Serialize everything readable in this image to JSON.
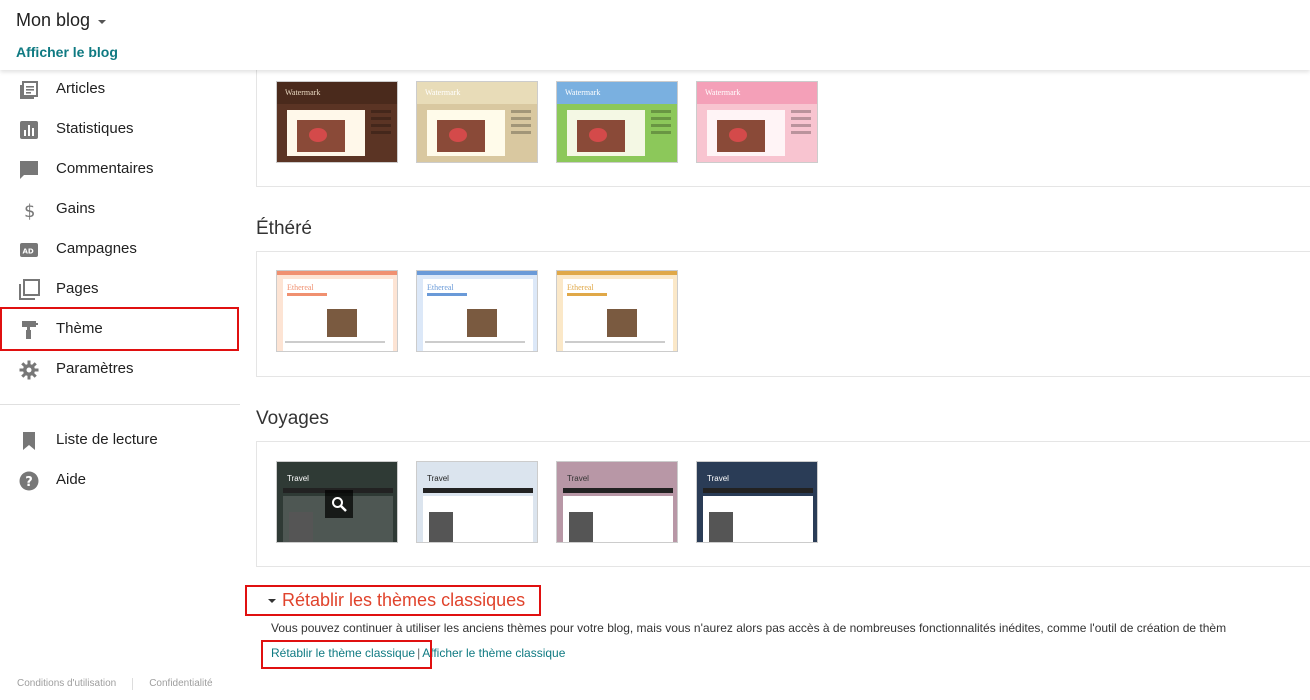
{
  "header": {
    "blog_name": "Mon blog",
    "view_blog": "Afficher le blog"
  },
  "sidebar": {
    "items": [
      {
        "label": "Articles",
        "icon": "articles-icon"
      },
      {
        "label": "Statistiques",
        "icon": "stats-icon"
      },
      {
        "label": "Commentaires",
        "icon": "comment-icon"
      },
      {
        "label": "Gains",
        "icon": "dollar-icon"
      },
      {
        "label": "Campagnes",
        "icon": "ad-icon"
      },
      {
        "label": "Pages",
        "icon": "pages-icon"
      },
      {
        "label": "Thème",
        "icon": "paint-roller-icon"
      },
      {
        "label": "Paramètres",
        "icon": "gear-icon"
      }
    ],
    "secondary": [
      {
        "label": "Liste de lecture",
        "icon": "bookmark-icon"
      },
      {
        "label": "Aide",
        "icon": "help-icon"
      }
    ],
    "footer": {
      "terms": "Conditions d'utilisation",
      "privacy": "Confidentialité"
    }
  },
  "sections": {
    "watermark": {
      "themes": [
        {
          "name": "Watermark",
          "header_color": "#4a2a1c",
          "bg": "#5b3424",
          "post": "#fff8ea"
        },
        {
          "name": "Watermark",
          "header_color": "#e8dcb8",
          "bg": "#d9c8a0",
          "post": "#fffbea"
        },
        {
          "name": "Watermark",
          "header_color": "#7ab0e0",
          "bg": "#8cc85a",
          "post": "#f4f8e4"
        },
        {
          "name": "Watermark",
          "header_color": "#f4a0b8",
          "bg": "#f8c4d0",
          "post": "#fff4f6"
        }
      ]
    },
    "ethere": {
      "title": "Éthéré",
      "themes": [
        {
          "name": "Ethereal",
          "accent": "#f09070",
          "bg": "#fde4d4"
        },
        {
          "name": "Ethereal",
          "accent": "#6a9ad8",
          "bg": "#dce8f8"
        },
        {
          "name": "Ethereal",
          "accent": "#e0a848",
          "bg": "#fbe8c8"
        }
      ]
    },
    "voyages": {
      "title": "Voyages",
      "themes": [
        {
          "name": "Travel",
          "bg": "#2f3a35"
        },
        {
          "name": "Travel",
          "bg": "#dbe4ee"
        },
        {
          "name": "Travel",
          "bg": "#b897a6"
        },
        {
          "name": "Travel",
          "bg": "#2a3c56"
        }
      ]
    },
    "classic": {
      "title": "Rétablir les thèmes classiques",
      "description": "Vous pouvez continuer à utiliser les anciens thèmes pour votre blog, mais vous n'aurez alors pas accès à de nombreuses fonctionnalités inédites, comme l'outil de création de thèm",
      "restore_link": "Rétablir le thème classique",
      "view_link": "Afficher le thème classique",
      "separator": "|"
    }
  },
  "colors": {
    "accent_red": "#e0432c",
    "link_teal": "#0f7a82",
    "highlight_box": "#e01010"
  }
}
